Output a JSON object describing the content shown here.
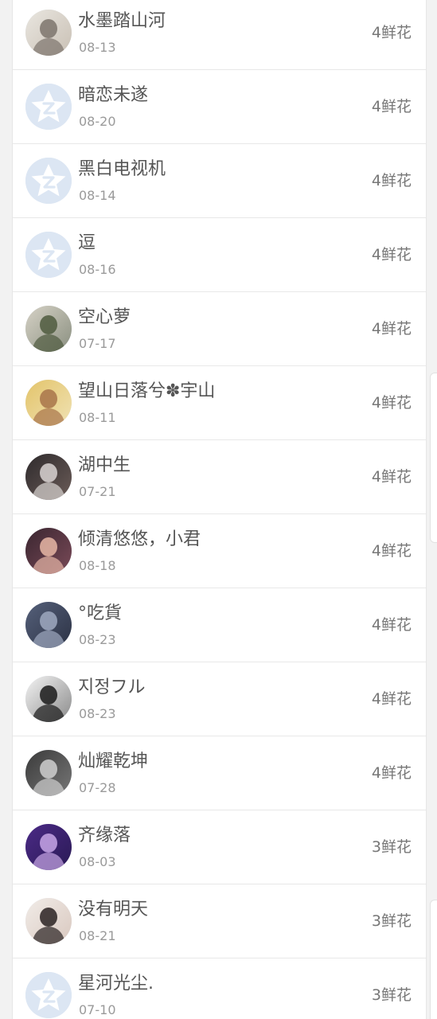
{
  "list": {
    "items": [
      {
        "name": "水墨踏山河",
        "date": "08-13",
        "flowers": "4鲜花",
        "avatar": "photo-portrait-ink",
        "colors": [
          "#e9e6e0",
          "#7c746c",
          "#c9c0b4"
        ]
      },
      {
        "name": "暗恋未遂",
        "date": "08-20",
        "flowers": "4鲜花",
        "avatar": "default-star-avatar"
      },
      {
        "name": "黑白电视机",
        "date": "08-14",
        "flowers": "4鲜花",
        "avatar": "default-star-avatar"
      },
      {
        "name": "逗",
        "date": "08-16",
        "flowers": "4鲜花",
        "avatar": "default-star-avatar"
      },
      {
        "name": "空心萝",
        "date": "07-17",
        "flowers": "4鲜花",
        "avatar": "photo-landscape-harbor",
        "colors": [
          "#d6d2c6",
          "#4f5a3e",
          "#8a8f80"
        ]
      },
      {
        "name": "望山日落兮✽宇山",
        "date": "08-11",
        "flowers": "4鲜花",
        "avatar": "photo-children-yellow",
        "colors": [
          "#e3c46a",
          "#a8744a",
          "#f0e2b4"
        ]
      },
      {
        "name": "湖中生",
        "date": "07-21",
        "flowers": "4鲜花",
        "avatar": "photo-couple-dark",
        "colors": [
          "#2e2a2c",
          "#d9d4d2",
          "#6b5c58"
        ]
      },
      {
        "name": "倾清悠悠，小君",
        "date": "08-18",
        "flowers": "4鲜花",
        "avatar": "photo-two-girls",
        "colors": [
          "#3a2630",
          "#e7b7a6",
          "#7a4a58"
        ]
      },
      {
        "name": "°吃貨",
        "date": "08-23",
        "flowers": "4鲜花",
        "avatar": "photo-blue-hair",
        "colors": [
          "#55607a",
          "#9fa9c0",
          "#2c3244"
        ]
      },
      {
        "name": "지정フル",
        "date": "08-23",
        "flowers": "4鲜花",
        "avatar": "photo-anime-bw",
        "colors": [
          "#f4f4f4",
          "#1a1a1a",
          "#8a8a8a"
        ]
      },
      {
        "name": "灿耀乾坤",
        "date": "07-28",
        "flowers": "4鲜花",
        "avatar": "photo-anime-grey",
        "colors": [
          "#3a3a3a",
          "#cfcfcf",
          "#777777"
        ]
      },
      {
        "name": "齐缘落",
        "date": "08-03",
        "flowers": "3鲜花",
        "avatar": "photo-anime-purple",
        "colors": [
          "#4b2a86",
          "#c7a6e6",
          "#2a1a55"
        ]
      },
      {
        "name": "没有明天",
        "date": "08-21",
        "flowers": "3鲜花",
        "avatar": "photo-boy-portrait",
        "colors": [
          "#f1ece8",
          "#2a2222",
          "#d9c8bf"
        ]
      },
      {
        "name": "星河光尘.",
        "date": "07-10",
        "flowers": "3鲜花",
        "avatar": "default-star-avatar"
      }
    ]
  },
  "theme": {
    "default_avatar_bg": "#dce6f3",
    "default_avatar_fg": "#ffffff"
  }
}
